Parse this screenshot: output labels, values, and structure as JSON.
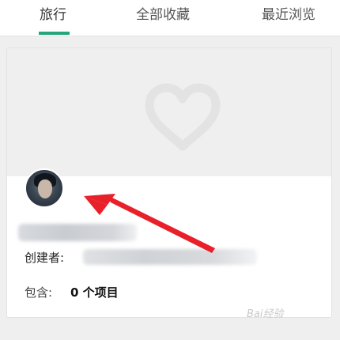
{
  "tabs": [
    {
      "label": "旅行",
      "active": true
    },
    {
      "label": "全部收藏",
      "active": false
    },
    {
      "label": "最近浏览",
      "active": false
    }
  ],
  "card": {
    "creator_label": "创建者:",
    "contains_label": "包含:",
    "contains_value": "0 个项目"
  },
  "colors": {
    "accent": "#24a57a",
    "annotation_arrow": "#e8202a"
  },
  "watermark": {
    "text": "Bai经验"
  }
}
